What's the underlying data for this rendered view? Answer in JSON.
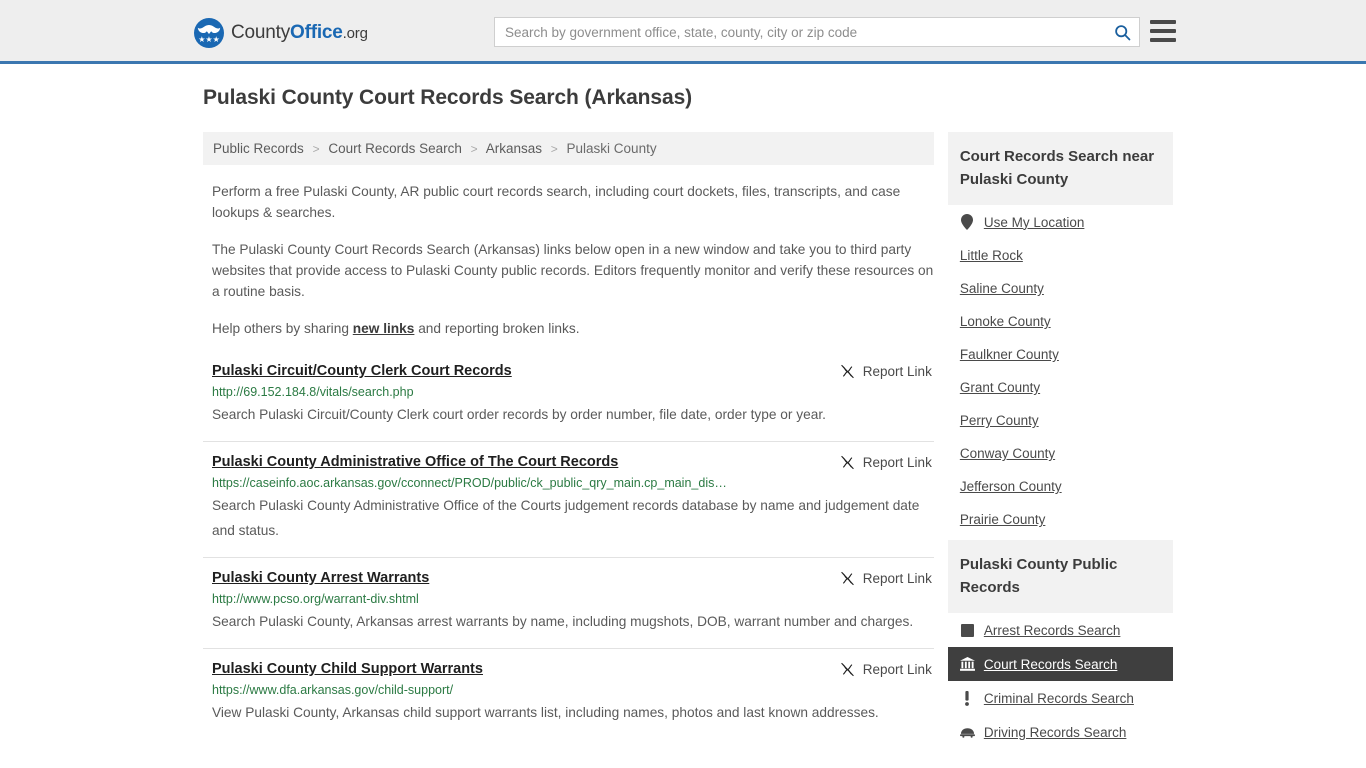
{
  "header": {
    "logo": {
      "part1": "County",
      "part2": "Office",
      "part3": ".org",
      "stars": "★★★"
    },
    "search": {
      "placeholder": "Search by government office, state, county, city or zip code",
      "value": "",
      "icon": "search-icon"
    },
    "menu_icon": "hamburger-menu-icon",
    "brand_color": "#1a68b3",
    "border_color": "#3b77b0"
  },
  "page_title": "Pulaski County Court Records Search (Arkansas)",
  "breadcrumb": {
    "items": [
      {
        "label": "Public Records",
        "current": false
      },
      {
        "label": "Court Records Search",
        "current": false
      },
      {
        "label": "Arkansas",
        "current": false
      },
      {
        "label": "Pulaski County",
        "current": true
      }
    ],
    "separator": ">"
  },
  "intro": {
    "p1": "Perform a free Pulaski County, AR public court records search, including court dockets, files, transcripts, and case lookups & searches.",
    "p2": "The Pulaski County Court Records Search (Arkansas) links below open in a new window and take you to third party websites that provide access to Pulaski County public records. Editors frequently monitor and verify these resources on a routine basis.",
    "p3_before": "Help others by sharing ",
    "p3_link": "new links",
    "p3_after": " and reporting broken links."
  },
  "report_link_label": "Report Link",
  "report_link_icon": "broken-link-icon",
  "results": [
    {
      "title": "Pulaski Circuit/County Clerk Court Records",
      "url": "http://69.152.184.8/vitals/search.php",
      "description": "Search Pulaski Circuit/County Clerk court order records by order number, file date, order type or year."
    },
    {
      "title": "Pulaski County Administrative Office of The Court Records",
      "url": "https://caseinfo.aoc.arkansas.gov/cconnect/PROD/public/ck_public_qry_main.cp_main_dis…",
      "description": "Search Pulaski County Administrative Office of the Courts judgement records database by name and judgement date and status."
    },
    {
      "title": "Pulaski County Arrest Warrants",
      "url": "http://www.pcso.org/warrant-div.shtml",
      "description": "Search Pulaski County, Arkansas arrest warrants by name, including mugshots, DOB, warrant number and charges."
    },
    {
      "title": "Pulaski County Child Support Warrants",
      "url": "https://www.dfa.arkansas.gov/child-support/",
      "description": "View Pulaski County, Arkansas child support warrants list, including names, photos and last known addresses."
    }
  ],
  "sidebar": {
    "nearby": {
      "title": "Court Records Search near Pulaski County",
      "items": [
        {
          "label": "Use My Location",
          "icon": "map-pin-icon",
          "active": false
        },
        {
          "label": "Little Rock",
          "icon": "",
          "active": false
        },
        {
          "label": "Saline County",
          "icon": "",
          "active": false
        },
        {
          "label": "Lonoke County",
          "icon": "",
          "active": false
        },
        {
          "label": "Faulkner County",
          "icon": "",
          "active": false
        },
        {
          "label": "Grant County",
          "icon": "",
          "active": false
        },
        {
          "label": "Perry County",
          "icon": "",
          "active": false
        },
        {
          "label": "Conway County",
          "icon": "",
          "active": false
        },
        {
          "label": "Jefferson County",
          "icon": "",
          "active": false
        },
        {
          "label": "Prairie County",
          "icon": "",
          "active": false
        }
      ]
    },
    "public_records": {
      "title": "Pulaski County Public Records",
      "items": [
        {
          "label": "Arrest Records Search",
          "icon": "square-icon",
          "active": false
        },
        {
          "label": "Court Records Search",
          "icon": "courthouse-icon",
          "active": true
        },
        {
          "label": "Criminal Records Search",
          "icon": "exclamation-icon",
          "active": false
        },
        {
          "label": "Driving Records Search",
          "icon": "car-icon",
          "active": false
        }
      ]
    }
  },
  "colors": {
    "url_green": "#2b7a43",
    "header_bg": "#eeeeee",
    "panel_bg": "#f2f2f2",
    "active_bg": "#3f3f3f"
  }
}
